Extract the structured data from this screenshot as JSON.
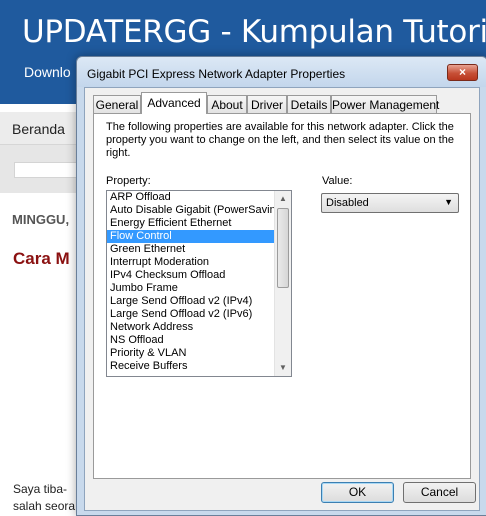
{
  "background_page": {
    "site_title": "UPDATERGG - Kumpulan Tutori",
    "nav_download": "Downlo",
    "menu_beranda": "Beranda",
    "date": "MINGGU,",
    "post_title": "Cara M",
    "body_line1": "Saya tiba-",
    "body_line2": "salah seora"
  },
  "dialog": {
    "title": "Gigabit PCI Express Network Adapter Properties",
    "close_icon": "×",
    "tabs": [
      {
        "label": "General",
        "active": false
      },
      {
        "label": "Advanced",
        "active": true
      },
      {
        "label": "About",
        "active": false
      },
      {
        "label": "Driver",
        "active": false
      },
      {
        "label": "Details",
        "active": false
      },
      {
        "label": "Power Management",
        "active": false
      }
    ],
    "description": "The following properties are available for this network adapter. Click the property you want to change on the left, and then select its value on the right.",
    "property_label": "Property:",
    "value_label": "Value:",
    "properties": [
      "ARP Offload",
      "Auto Disable Gigabit (PowerSaving",
      "Energy Efficient Ethernet",
      "Flow Control",
      "Green Ethernet",
      "Interrupt Moderation",
      "IPv4 Checksum Offload",
      "Jumbo Frame",
      "Large Send Offload v2 (IPv4)",
      "Large Send Offload v2 (IPv6)",
      "Network Address",
      "NS Offload",
      "Priority & VLAN",
      "Receive Buffers"
    ],
    "selected_property": "Flow Control",
    "value_selected": "Disabled",
    "scroll_up_icon": "▲",
    "scroll_down_icon": "▼",
    "dropdown_icon": "▼",
    "ok_label": "OK",
    "cancel_label": "Cancel"
  },
  "colors": {
    "header_blue": "#1f5a9e",
    "selection": "#3399ff",
    "post_title_red": "#8b1111"
  }
}
